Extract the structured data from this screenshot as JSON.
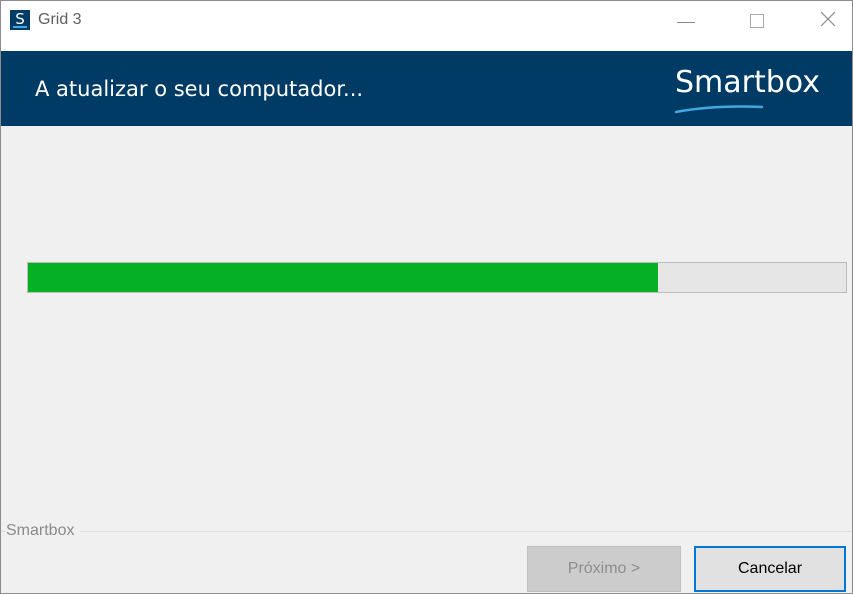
{
  "window": {
    "app_icon_letter": "S",
    "title": "Grid 3"
  },
  "banner": {
    "title": "A atualizar o seu computador...",
    "logo_text": "Smartbox"
  },
  "progress": {
    "percent": 77
  },
  "footer": {
    "group_label": "Smartbox",
    "next_label": "Próximo >",
    "cancel_label": "Cancelar"
  },
  "colors": {
    "banner": "#003b66",
    "progress_fill": "#06b025",
    "focus_border": "#0078d7"
  }
}
